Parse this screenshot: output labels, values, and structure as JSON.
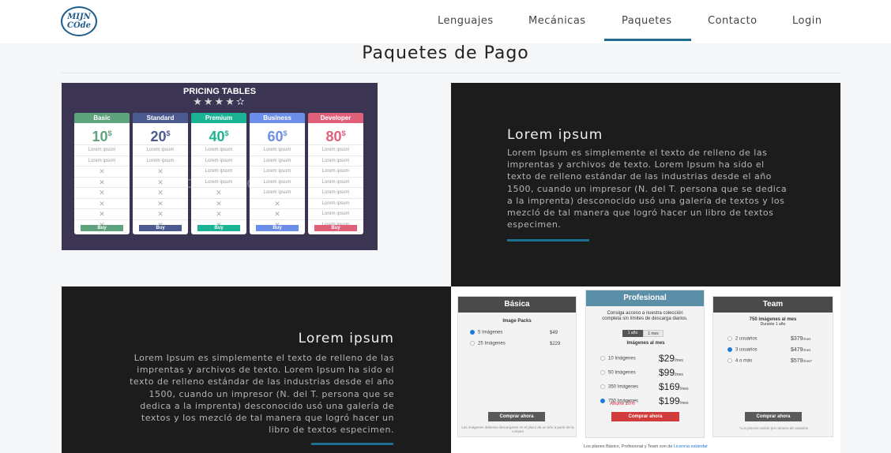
{
  "header": {
    "logo_line1": "MIJN",
    "logo_line2": "COde",
    "nav": [
      "Lenguajes",
      "Mecánicas",
      "Paquetes",
      "Contacto",
      "Login"
    ],
    "active_nav": "Paquetes"
  },
  "page": {
    "title": "Paquetes de Pago"
  },
  "pricing_tables_image": {
    "title": "PRICING TABLES",
    "stars": "★★★★✫",
    "watermark": "depositphotos",
    "row_text": "Lorem ipsum",
    "cross": "✕",
    "buy_label": "Buy",
    "plans": [
      {
        "name": "Basic",
        "price": "10",
        "currency": "$",
        "color": "#5fa37d"
      },
      {
        "name": "Standard",
        "price": "20",
        "currency": "$",
        "color": "#4b5a8f"
      },
      {
        "name": "Premium",
        "price": "40",
        "currency": "$",
        "color": "#1ab394"
      },
      {
        "name": "Business",
        "price": "60",
        "currency": "$",
        "color": "#6b8ee8"
      },
      {
        "name": "Developer",
        "price": "80",
        "currency": "$",
        "color": "#e0607a"
      }
    ]
  },
  "panel1": {
    "title": "Lorem ipsum",
    "text": "Lorem Ipsum es simplemente el texto de relleno de las imprentas y archivos de texto. Lorem Ipsum ha sido el texto de relleno estándar de las industrias desde el año 1500, cuando un impresor (N. del T. persona que se dedica a la imprenta) desconocido usó una galería de textos y los mezcló de tal manera que logró hacer un libro de textos especimen."
  },
  "panel2": {
    "title": "Lorem ipsum",
    "text": "Lorem Ipsum es simplemente el texto de relleno de las imprentas y archivos de texto. Lorem Ipsum ha sido el texto de relleno estándar de las industrias desde el año 1500, cuando un impresor (N. del T. persona que se dedica a la imprenta) desconocido usó una galería de textos y los mezcló de tal manera que logró hacer un libro de textos especimen."
  },
  "pricing_image_2": {
    "basica": {
      "title": "Básica",
      "subtitle": "Image Packs",
      "rows": [
        {
          "label": "5 Imágenes",
          "price": "$49",
          "selected": true
        },
        {
          "label": "25 Imágenes",
          "price": "$229",
          "selected": false
        }
      ],
      "button": "Comprar ahora",
      "note": "Las imágenes deberán descargarse en el plazo de un año a partir de la compra"
    },
    "profesional": {
      "title": "Profesional",
      "desc": "Consiga acceso a nuestra colección completa sin límites de descarga diarios.",
      "toggle_a": "1 año",
      "toggle_b": "1 mes",
      "subtitle": "Imágenes al mes",
      "rows": [
        {
          "label": "10 Imágenes",
          "price": "$29",
          "unit": "/mes",
          "selected": false
        },
        {
          "label": "50 Imágenes",
          "price": "$99",
          "unit": "/mes",
          "selected": false
        },
        {
          "label": "350 Imágenes",
          "price": "$169",
          "unit": "/mes",
          "selected": false
        },
        {
          "label": "750 Imágenes",
          "price": "$199",
          "unit": "/mes",
          "selected": true
        }
      ],
      "saving": "Ahorre 20%",
      "button": "Comprar ahora"
    },
    "team": {
      "title": "Team",
      "subtitle": "750 imágenes al mes",
      "sub2": "Durante 1 año",
      "rows": [
        {
          "label": "2 usuarios",
          "price": "$379",
          "unit": "/mes",
          "selected": false
        },
        {
          "label": "3 usuarios",
          "price": "$479",
          "unit": "/mes",
          "selected": true
        },
        {
          "label": "4 o más",
          "price": "$579",
          "unit": "/mes*",
          "selected": false
        }
      ],
      "button": "Comprar ahora",
      "note": "*Los precios varían por número de usuarios"
    },
    "footer": "Los planes Básico, Profesional y Team son de ",
    "footer_link": "Licencia estándar"
  }
}
